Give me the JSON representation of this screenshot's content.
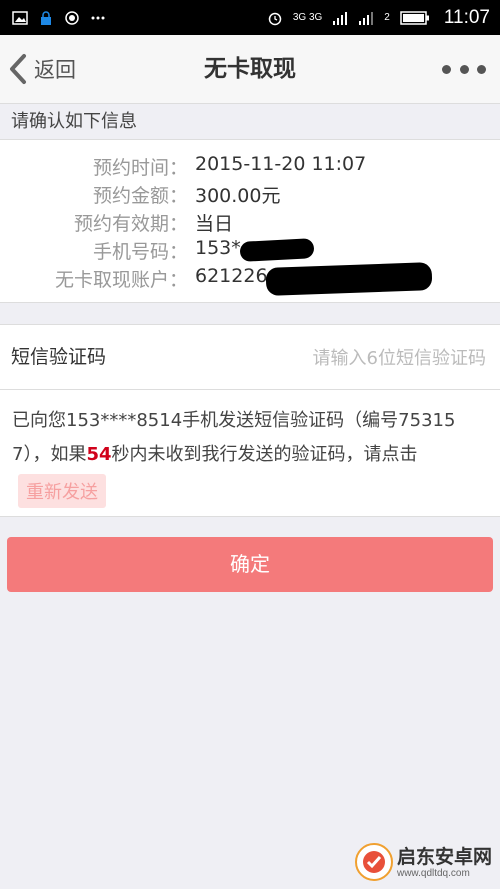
{
  "status_bar": {
    "net_label": "3G 3G",
    "sim_label": "2",
    "time": "11:07"
  },
  "header": {
    "back_label": "返回",
    "title": "无卡取现"
  },
  "confirm_section": {
    "header": "请确认如下信息",
    "rows": [
      {
        "label": "预约时间：",
        "value": "2015-11-20 11:07"
      },
      {
        "label": "预约金额：",
        "value": "300.00元"
      },
      {
        "label": "预约有效期：",
        "value": "当日"
      },
      {
        "label": "手机号码：",
        "value": "153*"
      },
      {
        "label": "无卡取现账户：",
        "value": "621226"
      }
    ]
  },
  "sms": {
    "label": "短信验证码",
    "placeholder": "请输入6位短信验证码",
    "value": ""
  },
  "notice": {
    "text_before": "已向您153****8514手机发送短信验证码（编号753157），如果",
    "countdown": "54",
    "text_after": "秒内未收到我行发送的验证码，请点击",
    "resend_label": "重新发送"
  },
  "confirm_button": "确定",
  "watermark": {
    "name": "启东安卓网",
    "url": "www.qdltdq.com"
  },
  "colors": {
    "confirm_button": "#f47a7b",
    "countdown": "#d0021b",
    "resend_bg": "#fde0e0"
  }
}
